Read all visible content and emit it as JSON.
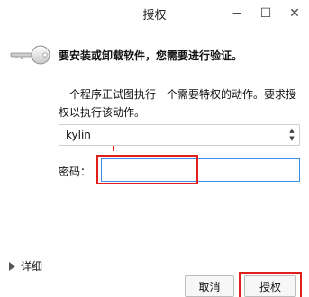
{
  "window": {
    "title": "授权",
    "minimize_symbol": "−",
    "maximize_symbol": "☐",
    "close_symbol": "✕"
  },
  "dialog": {
    "headline": "要安装或卸载软件，您需要进行验证。",
    "description": "一个程序正试图执行一个需要特权的动作。要求授权以执行该动作。",
    "user_selected": "kylin",
    "password_label": "密码：",
    "password_value": "",
    "details_label": "详细",
    "cancel_label": "取消",
    "authorize_label": "授权"
  },
  "icons": {
    "key": "key-icon",
    "expand": "triangle-right-icon",
    "spinner_up": "chevron-up-icon",
    "spinner_down": "chevron-down-icon"
  },
  "colors": {
    "highlight": "#e0201a",
    "input_focus_border": "#3d8ee8"
  }
}
